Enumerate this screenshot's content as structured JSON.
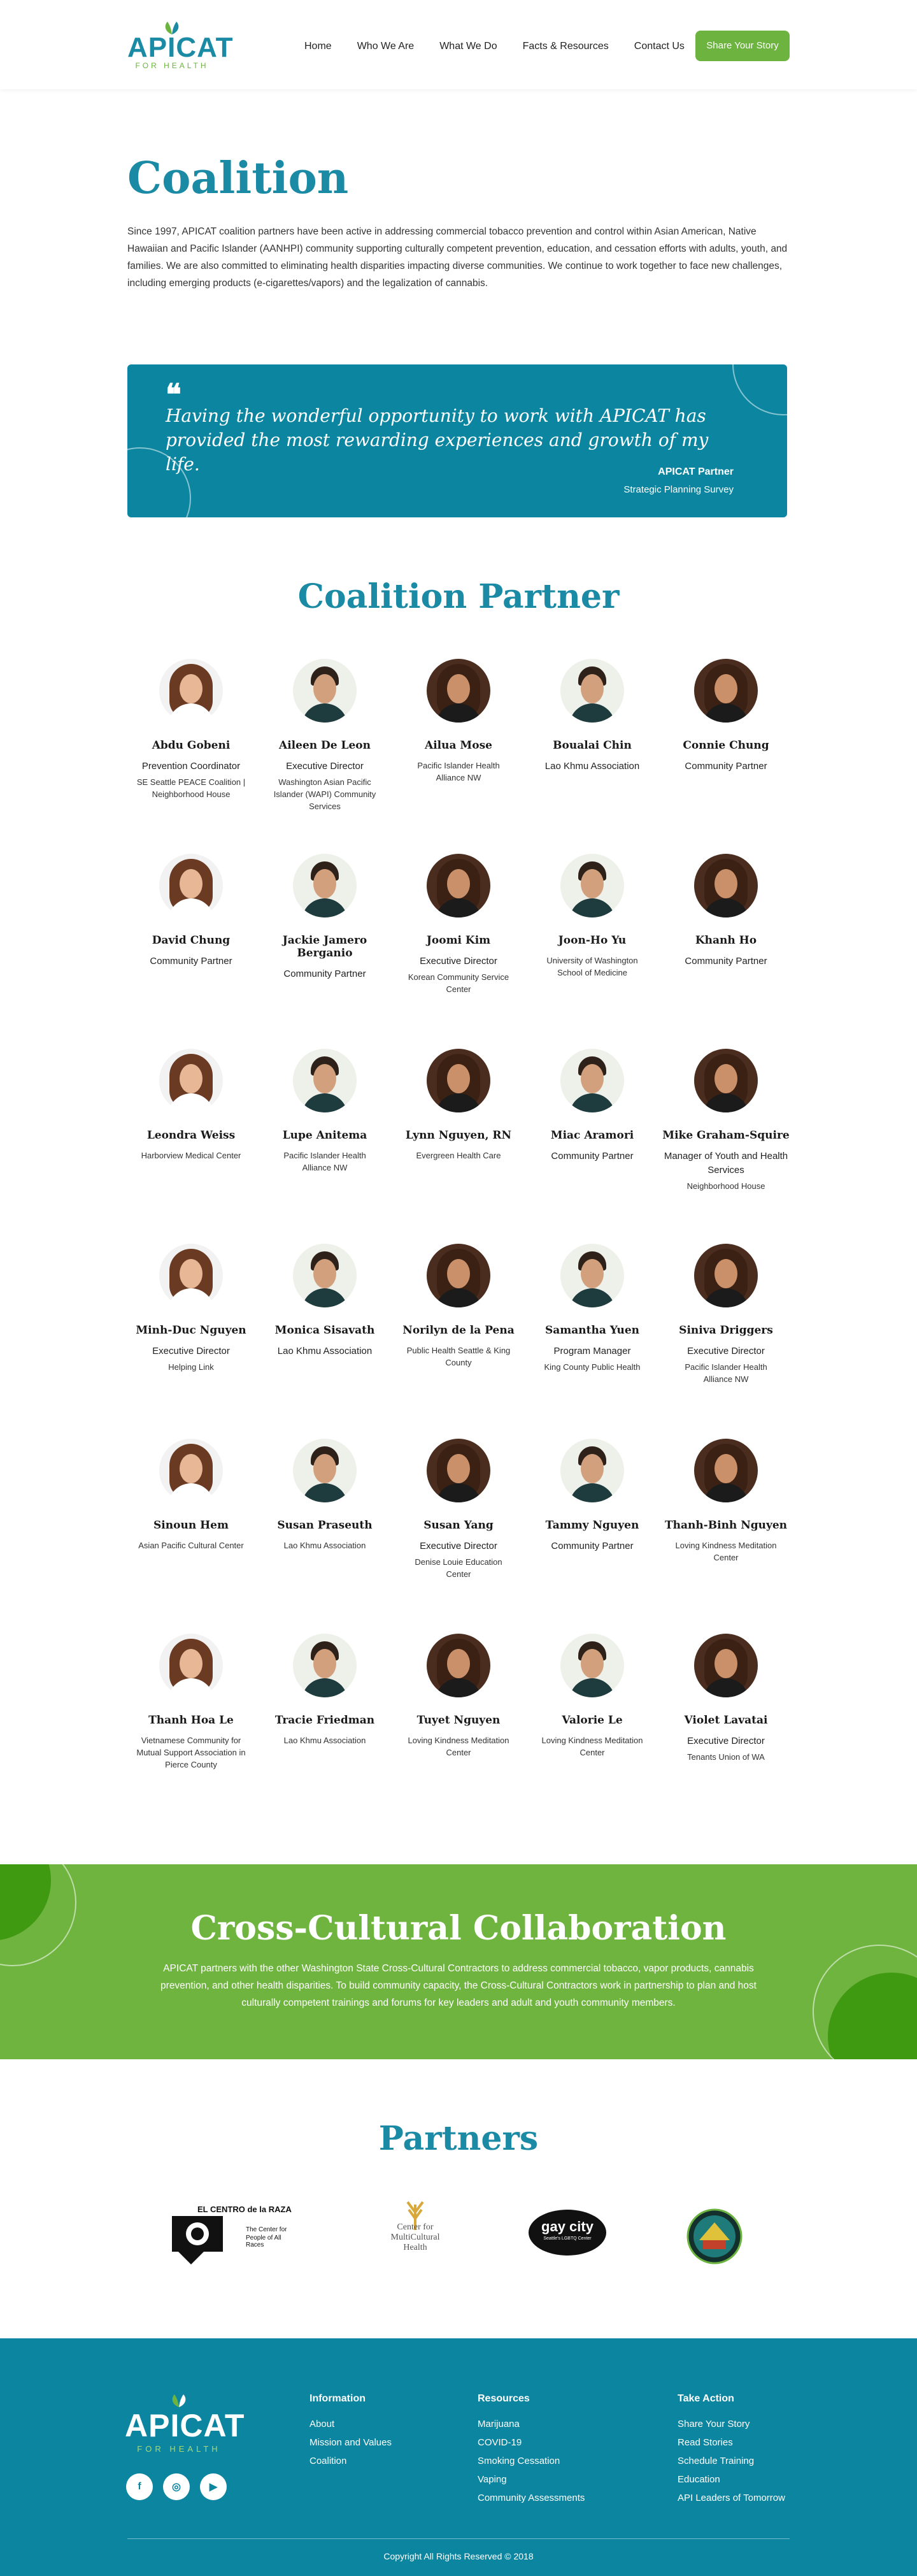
{
  "header": {
    "logo_text": "APICAT",
    "logo_tagline": "FOR HEALTH",
    "nav": [
      "Home",
      "Who We Are",
      "What We Do",
      "Facts & Resources",
      "Contact Us"
    ],
    "cta": "Share Your Story"
  },
  "intro": {
    "title": "Coalition",
    "text": "Since 1997, APICAT coalition partners have been active in addressing commercial tobacco prevention and control within Asian American, Native Hawaiian and Pacific Islander (AANHPI) community supporting culturally competent prevention, education, and cessation efforts with adults, youth, and families. We are also committed to eliminating health disparities impacting diverse communities. We continue to work together to face new challenges, including emerging products (e-cigarettes/vapors) and the legalization of cannabis."
  },
  "quote": {
    "mark": "❝",
    "text": "Having the wonderful opportunity to work with APICAT has provided the most rewarding experiences and growth of my life.",
    "name": "APICAT Partner",
    "source": "Strategic Planning Survey"
  },
  "partners_title": "Coalition Partner",
  "partners": [
    [
      {
        "name": "Abdu Gobeni",
        "role": "Prevention Coordinator",
        "org": "SE Seattle PEACE Coalition | Neighborhood House",
        "avatar": "a"
      },
      {
        "name": "Aileen De Leon",
        "role": "Executive Director",
        "org": "Washington Asian Pacific Islander (WAPI) Community Services",
        "avatar": "b"
      },
      {
        "name": "Ailua Mose",
        "role": "",
        "org": "Pacific Islander Health Alliance NW",
        "avatar": "c"
      },
      {
        "name": "Boualai Chin",
        "role": "Lao Khmu Association",
        "org": "",
        "avatar": "b"
      },
      {
        "name": "Connie Chung",
        "role": "Community Partner",
        "org": "",
        "avatar": "c"
      }
    ],
    [
      {
        "name": "David Chung",
        "role": "Community Partner",
        "org": "",
        "avatar": "a"
      },
      {
        "name": "Jackie Jamero Berganio",
        "role": "Community Partner",
        "org": "",
        "avatar": "b"
      },
      {
        "name": "Joomi Kim",
        "role": "Executive Director",
        "org": "Korean Community Service Center",
        "avatar": "c"
      },
      {
        "name": "Joon-Ho Yu",
        "role": "",
        "org": "University of Washington School of Medicine",
        "avatar": "b"
      },
      {
        "name": "Khanh Ho",
        "role": "Community Partner",
        "org": "",
        "avatar": "c"
      }
    ],
    [
      {
        "name": "Leondra Weiss",
        "role": "",
        "org": "Harborview Medical Center",
        "avatar": "a"
      },
      {
        "name": "Lupe Anitema",
        "role": "",
        "org": "Pacific Islander Health Alliance NW",
        "avatar": "b"
      },
      {
        "name": "Lynn Nguyen, RN",
        "role": "",
        "org": "Evergreen Health Care",
        "avatar": "c"
      },
      {
        "name": "Miac Aramori",
        "role": "Community Partner",
        "org": "",
        "avatar": "b"
      },
      {
        "name": "Mike Graham-Squire",
        "role": "Manager of Youth and Health Services",
        "org": "Neighborhood House",
        "avatar": "c"
      }
    ],
    [
      {
        "name": "Minh-Duc Nguyen",
        "role": "Executive Director",
        "org": "Helping Link",
        "avatar": "a"
      },
      {
        "name": "Monica Sisavath",
        "role": "Lao Khmu Association",
        "org": "",
        "avatar": "b"
      },
      {
        "name": "Norilyn de la Pena",
        "role": "",
        "org": "Public Health Seattle & King County",
        "avatar": "c"
      },
      {
        "name": "Samantha Yuen",
        "role": "Program Manager",
        "org": "King County Public Health",
        "avatar": "b"
      },
      {
        "name": "Siniva Driggers",
        "role": "Executive Director",
        "org": "Pacific Islander Health Alliance NW",
        "avatar": "c"
      }
    ],
    [
      {
        "name": "Sinoun Hem",
        "role": "",
        "org": "Asian Pacific Cultural Center",
        "avatar": "a"
      },
      {
        "name": "Susan Praseuth",
        "role": "",
        "org": "Lao Khmu Association",
        "avatar": "b"
      },
      {
        "name": "Susan Yang",
        "role": "Executive Director",
        "org": "Denise Louie Education Center",
        "avatar": "c"
      },
      {
        "name": "Tammy Nguyen",
        "role": "Community Partner",
        "org": "",
        "avatar": "b"
      },
      {
        "name": "Thanh-Binh Nguyen",
        "role": "",
        "org": "Loving Kindness Meditation Center",
        "avatar": "c"
      }
    ],
    [
      {
        "name": "Thanh Hoa Le",
        "role": "",
        "org": "Vietnamese Community for Mutual Support Association in Pierce County",
        "avatar": "a"
      },
      {
        "name": "Tracie Friedman",
        "role": "",
        "org": "Lao Khmu Association",
        "avatar": "b"
      },
      {
        "name": "Tuyet Nguyen",
        "role": "",
        "org": "Loving Kindness Meditation Center",
        "avatar": "c"
      },
      {
        "name": "Valorie Le",
        "role": "",
        "org": "Loving Kindness Meditation Center",
        "avatar": "b"
      },
      {
        "name": "Violet Lavatai",
        "role": "Executive Director",
        "org": "Tenants Union of WA",
        "avatar": "c"
      }
    ]
  ],
  "cross_cultural": {
    "title": "Cross-Cultural Collaboration",
    "text": "APICAT partners with the other Washington State Cross-Cultural Contractors to address commercial tobacco, vapor products, cannabis prevention, and other health disparities. To build community capacity, the Cross-Cultural Contractors work in partnership to plan and host culturally competent trainings and forums for key leaders and adult and youth community members."
  },
  "logos": {
    "title": "Partners",
    "el_centro_name": "EL CENTRO de la RAZA",
    "el_centro_tagline_1": "The Center for",
    "el_centro_tagline_2": "People of All Races",
    "cmch_1": "Center for",
    "cmch_2": "MultiCultural",
    "cmch_3": "Health",
    "gaycity_1": "gay city",
    "gaycity_2": "Seattle's LGBTQ Center"
  },
  "footer": {
    "logo_text": "APICAT",
    "logo_tagline": "FOR HEALTH",
    "social": [
      "f",
      "◎",
      "▶"
    ],
    "information_title": "Information",
    "information": [
      "About",
      "Mission and Values",
      "Coalition"
    ],
    "resources_title": "Resources",
    "resources": [
      "Marijuana",
      "COVID-19",
      "Smoking Cessation",
      "Vaping",
      "Community Assessments"
    ],
    "action_title": "Take Action",
    "action": [
      "Share Your Story",
      "Read Stories",
      "Schedule Training",
      "Education",
      "API Leaders of Tomorrow"
    ],
    "copyright": "Copyright All Rights Reserved © 2018"
  },
  "colors": {
    "teal": "#0c86a0",
    "brand_blue": "#1b8aa5",
    "green": "#6fb43f"
  }
}
